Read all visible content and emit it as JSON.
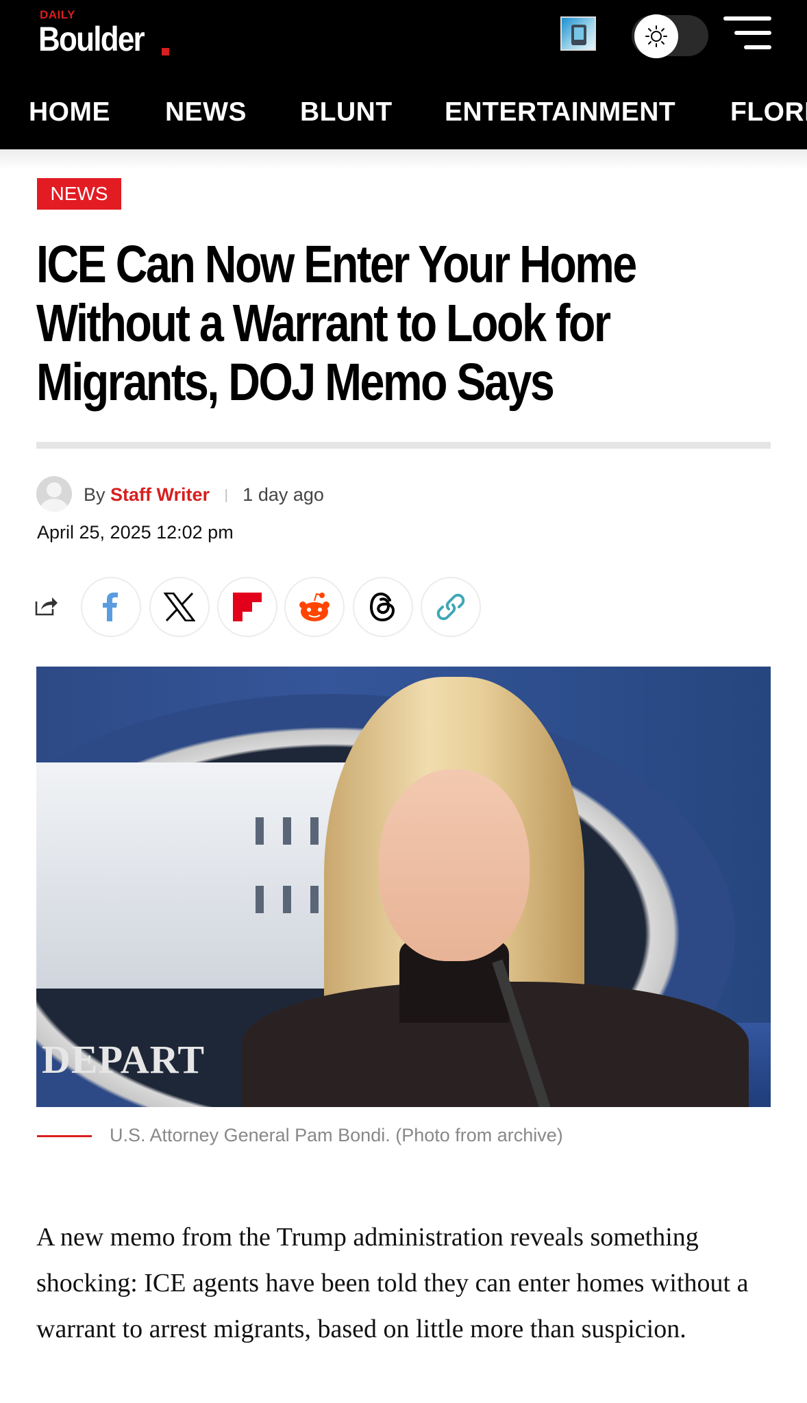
{
  "site": {
    "brand_small": "DAILY",
    "brand_name": "Boulder"
  },
  "nav": {
    "items": [
      "HOME",
      "NEWS",
      "BLUNT",
      "ENTERTAINMENT",
      "FLORI"
    ]
  },
  "article": {
    "category": "NEWS",
    "headline": "ICE Can Now Enter Your Home Without a Warrant to Look for Migrants, DOJ Memo Says",
    "byline": {
      "by": "By",
      "author": "Staff Writer",
      "relative_time": "1 day ago"
    },
    "date": "April 25, 2025 12:02 pm",
    "share_buttons": [
      "facebook-icon",
      "x-icon",
      "flipboard-icon",
      "reddit-icon",
      "threads-icon",
      "link-icon"
    ],
    "photo": {
      "sign_text": "DEPART"
    },
    "caption": "U.S. Attorney General Pam Bondi. (Photo from archive)",
    "body": "A new memo from the Trump administration reveals something shocking: ICE agents have been told they can enter homes without a warrant to arrest migrants, based on little more than suspicion."
  },
  "colors": {
    "accent": "#e31b23",
    "header_bg": "#000000"
  }
}
